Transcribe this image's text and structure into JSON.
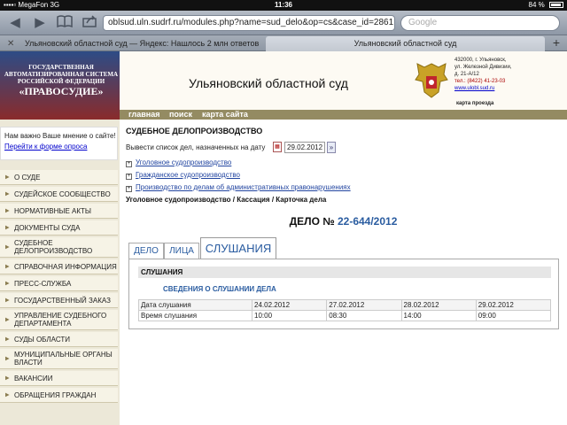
{
  "status_bar": {
    "carrier": "MegaFon",
    "network": "3G",
    "time": "11:36",
    "battery": "84 %"
  },
  "browser": {
    "url": "oblsud.uln.sudrf.ru/modules.php?name=sud_delo&op=cs&case_id=2861",
    "search_placeholder": "Google",
    "tabs": [
      {
        "title": "Ульяновский областной суд — Яндекс: Нашлось 2 млн ответов"
      },
      {
        "title": "Ульяновский областной суд"
      }
    ],
    "tab_add": "+"
  },
  "site": {
    "banner": {
      "line1": "ГОСУДАРСТВЕННАЯ",
      "line2": "АВТОМАТИЗИРОВАННАЯ СИСТЕМА",
      "line3": "РОССИЙСКОЙ ФЕДЕРАЦИИ",
      "line4": "«ПРАВОСУДИЕ»"
    },
    "court_name": "Ульяновский областной суд",
    "address": [
      "432000, г. Ульяновск,",
      "ул. Железной Дивизии,",
      "д. 21-А/12"
    ],
    "phone": "тел.: (8422) 41-23-03",
    "email": "www.ulobl.sud.ru",
    "map_link": "карта проезда",
    "nav": [
      "главная",
      "поиск",
      "карта сайта"
    ]
  },
  "sidebar": {
    "opinion_text": "Нам важно Ваше мнение о сайте!",
    "opinion_link": "Перейти к форме опроса",
    "menu": [
      "О СУДЕ",
      "СУДЕЙСКОЕ СООБЩЕСТВО",
      "НОРМАТИВНЫЕ АКТЫ",
      "ДОКУМЕНТЫ СУДА",
      "СУДЕБНОЕ ДЕЛОПРОИЗВОДСТВО",
      "СПРАВОЧНАЯ ИНФОРМАЦИЯ",
      "ПРЕСС-СЛУЖБА",
      "ГОСУДАРСТВЕННЫЙ ЗАКАЗ",
      "УПРАВЛЕНИЕ СУДЕБНОГО ДЕПАРТАМЕНТА",
      "СУДЫ ОБЛАСТИ",
      "МУНИЦИПАЛЬНЫЕ ОРГАНЫ ВЛАСТИ",
      "ВАКАНСИИ",
      "ОБРАЩЕНИЯ ГРАЖДАН"
    ]
  },
  "main": {
    "section_title": "СУДЕБНОЕ ДЕЛОПРОИЗВОДСТВО",
    "filter_label": "Вывести список дел, назначенных на дату",
    "filter_date": "29.02.2012",
    "go_button": "»",
    "categories": [
      "Уголовное судопроизводство",
      "Гражданское судопроизводство",
      "Производство по делам об административных правонарушениях"
    ],
    "breadcrumb": "Уголовное судопроизводство / Кассация / Карточка дела",
    "case_prefix": "ДЕЛО №",
    "case_number": "22-644/2012",
    "tabs": [
      "ДЕЛО",
      "ЛИЦА",
      "СЛУШАНИЯ"
    ],
    "panel_title": "СЛУШАНИЯ",
    "panel_subtitle": "СВЕДЕНИЯ О СЛУШАНИИ ДЕЛА",
    "hearings": {
      "date_label": "Дата слушания",
      "time_label": "Время слушания",
      "dates": [
        "24.02.2012",
        "27.02.2012",
        "28.02.2012",
        "29.02.2012"
      ],
      "times": [
        "10:00",
        "08:30",
        "14:00",
        "09:00"
      ]
    }
  }
}
